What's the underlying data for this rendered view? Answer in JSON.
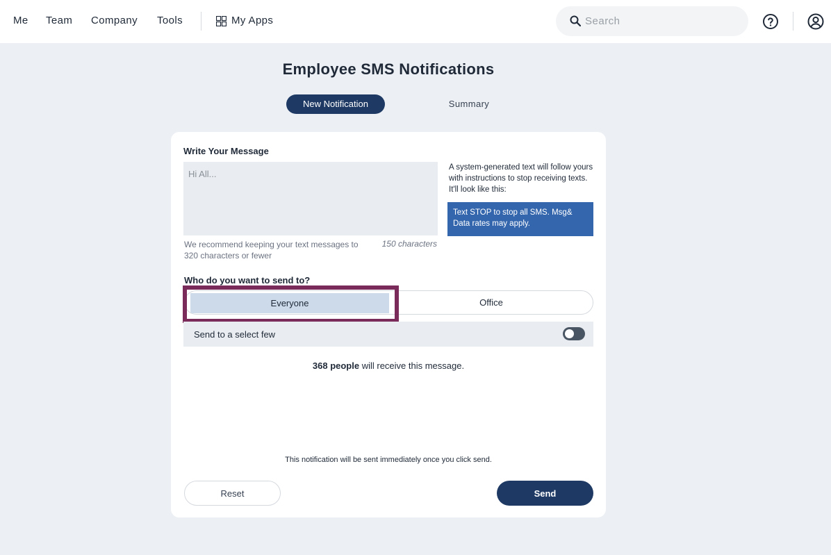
{
  "nav": {
    "items": [
      "Me",
      "Team",
      "Company",
      "Tools"
    ],
    "apps_label": "My Apps",
    "apps_icon": "grid-icon",
    "search_placeholder": "Search",
    "search_icon": "search-icon",
    "help_icon": "help-circle-icon",
    "user_icon": "user-circle-icon"
  },
  "page": {
    "title": "Employee SMS Notifications",
    "tabs": [
      {
        "label": "New Notification",
        "active": true
      },
      {
        "label": "Summary",
        "active": false
      }
    ]
  },
  "form": {
    "message_label": "Write Your Message",
    "message_placeholder": "Hi All...",
    "hint": "We recommend keeping your text messages to 320 characters or fewer",
    "char_count": "150 characters",
    "system_note": "A system-generated text will follow yours with instructions to stop receiving texts. It'll look like this:",
    "stop_text": "Text STOP to stop all SMS. Msg& Data rates may apply.",
    "audience_label": "Who do you want to send to?",
    "audience_options": [
      "Everyone",
      "Office"
    ],
    "audience_selected": "Everyone",
    "select_few_label": "Send to a select few",
    "select_few_enabled": false,
    "recipients_count": "368 people",
    "recipients_suffix": " will receive this message.",
    "send_note": "This notification will be sent immediately once you click send.",
    "reset_label": "Reset",
    "send_label": "Send"
  },
  "colors": {
    "primary": "#1e3a64",
    "stop_box": "#3466ad",
    "selected_option": "#ccdaea",
    "focus_ring": "#7a2b59",
    "background": "#ecf0f4"
  }
}
